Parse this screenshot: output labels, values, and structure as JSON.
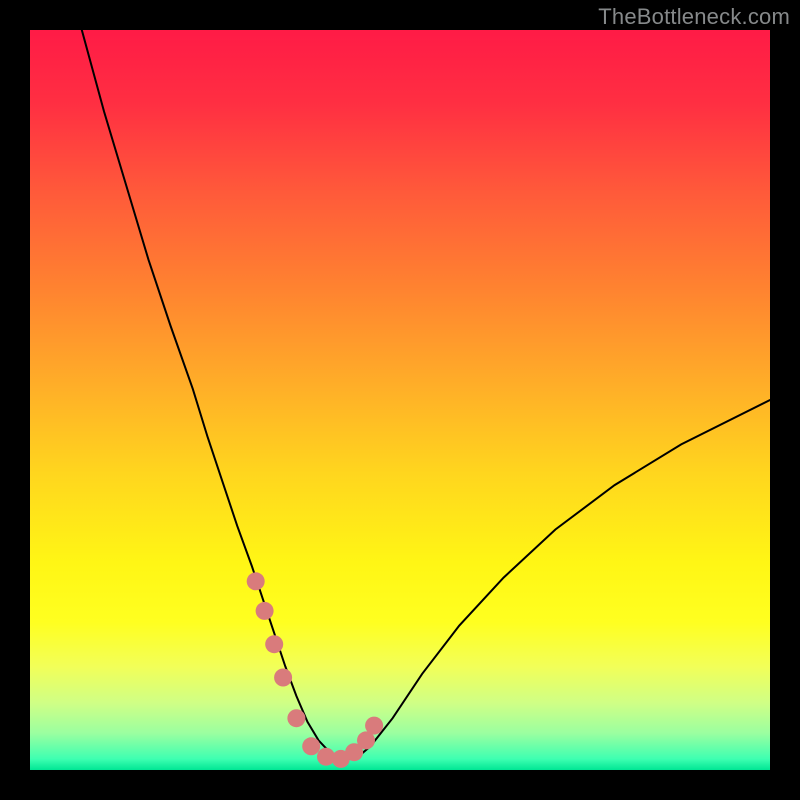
{
  "watermark": "TheBottleneck.com",
  "colors": {
    "marker_fill": "#d97b7c",
    "curve_stroke": "#000000",
    "frame_bg": "#000000",
    "gradient_stops": [
      {
        "offset": 0.0,
        "color": "#ff1b46"
      },
      {
        "offset": 0.1,
        "color": "#ff2f42"
      },
      {
        "offset": 0.22,
        "color": "#ff5a3a"
      },
      {
        "offset": 0.35,
        "color": "#ff8330"
      },
      {
        "offset": 0.48,
        "color": "#ffae28"
      },
      {
        "offset": 0.6,
        "color": "#ffd61e"
      },
      {
        "offset": 0.72,
        "color": "#fff615"
      },
      {
        "offset": 0.8,
        "color": "#ffff20"
      },
      {
        "offset": 0.86,
        "color": "#f2ff58"
      },
      {
        "offset": 0.91,
        "color": "#cfff86"
      },
      {
        "offset": 0.95,
        "color": "#9bffa0"
      },
      {
        "offset": 0.985,
        "color": "#3effb1"
      },
      {
        "offset": 1.0,
        "color": "#00e694"
      }
    ]
  },
  "chart_data": {
    "type": "line",
    "title": "",
    "xlabel": "",
    "ylabel": "",
    "xlim": [
      0,
      100
    ],
    "ylim": [
      0,
      100
    ],
    "grid": false,
    "x": [
      7,
      10,
      13,
      16,
      19,
      22,
      24,
      26,
      28,
      30,
      31.5,
      33,
      34.5,
      36,
      37.5,
      39,
      40.5,
      42,
      44,
      46,
      49,
      53,
      58,
      64,
      71,
      79,
      88,
      100
    ],
    "series": [
      {
        "name": "bottleneck",
        "values": [
          100,
          89,
          79,
          69,
          60,
          51.5,
          45,
          39,
          33,
          27.5,
          23,
          18.5,
          14,
          10,
          6.5,
          4,
          2.4,
          1.5,
          1.5,
          3.2,
          7,
          13,
          19.5,
          26,
          32.5,
          38.5,
          44,
          50
        ]
      }
    ],
    "markers": {
      "name": "highlight-dots",
      "x": [
        30.5,
        31.7,
        33.0,
        34.2,
        36.0,
        38.0,
        40.0,
        42.0,
        43.8,
        45.4,
        46.5
      ],
      "y": [
        25.5,
        21.5,
        17.0,
        12.5,
        7.0,
        3.2,
        1.8,
        1.5,
        2.4,
        4.0,
        6.0
      ],
      "radius": 9
    }
  }
}
